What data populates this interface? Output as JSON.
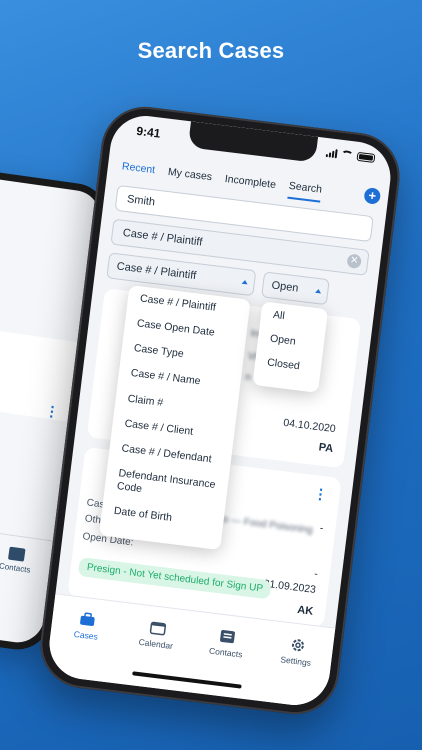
{
  "headline": "Search Cases",
  "back_phone": {
    "tab_label": "Contacts"
  },
  "status_bar": {
    "time": "9:41"
  },
  "tabs": [
    {
      "label": "Recent"
    },
    {
      "label": "My cases"
    },
    {
      "label": "Incomplete"
    },
    {
      "label": "Search"
    }
  ],
  "search": {
    "value": "Smith"
  },
  "filter_field": {
    "value": "Case # / Plaintiff"
  },
  "type_select": {
    "value": "Case # / Plaintiff"
  },
  "status_select": {
    "value": "Open"
  },
  "type_options": [
    "Case # / Plaintiff",
    "Case Open Date",
    "Case Type",
    "Case # / Name",
    "Claim #",
    "Case # / Client",
    "Case # / Defendant",
    "Defendant Insurance Code",
    "Date of Birth"
  ],
  "status_options": [
    "All",
    "Open",
    "Closed"
  ],
  "cards": [
    {
      "date": "04.10.2020",
      "initials": "PA"
    },
    {
      "case_type_label": "Case Type:",
      "other_plaintiffs_label": "Other Plaintiffs:",
      "open_date_label": "Open Date:",
      "dash": "-",
      "date": "21.09.2023",
      "status": "Presign - Not Yet scheduled for Sign UP",
      "initials": "AK",
      "status_color": "#1fae6b"
    }
  ],
  "bottom_nav": [
    {
      "label": "Cases",
      "icon": "briefcase-icon"
    },
    {
      "label": "Calendar",
      "icon": "calendar-icon"
    },
    {
      "label": "Contacts",
      "icon": "contact-card-icon"
    },
    {
      "label": "Settings",
      "icon": "gear-icon"
    }
  ],
  "colors": {
    "accent": "#1d6fd6",
    "background": "#1f6fc4"
  }
}
